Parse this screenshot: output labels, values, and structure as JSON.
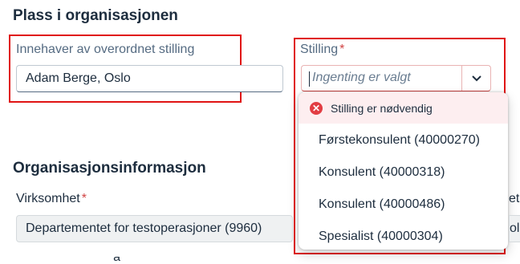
{
  "placement": {
    "title": "Plass i organisasjonen",
    "manager_label": "Innehaver av overordnet stilling",
    "manager_value": "Adam Berge, Oslo",
    "position_label": "Stilling",
    "position_required": "*",
    "position_placeholder": "Ingenting er valgt"
  },
  "dropdown": {
    "error_text": "Stilling er nødvendig",
    "options": [
      "Førstekonsulent (40000270)",
      "Konsulent (40000318)",
      "Konsulent (40000486)",
      "Spesialist (40000304)"
    ]
  },
  "org_info": {
    "title": "Organisasjonsinformasjon",
    "company_label": "Virksomhet",
    "company_required": "*",
    "company_value": "Departementet for testoperasjoner (9960)",
    "right_label_partial": "et",
    "right_value_partial": "ol",
    "bottom_label_partial": "å"
  },
  "colors": {
    "highlight": "#e01414",
    "error_bg": "#fdeef0",
    "error_icon": "#e23d43",
    "required": "#d04343",
    "focus": "#0a6ed1"
  }
}
